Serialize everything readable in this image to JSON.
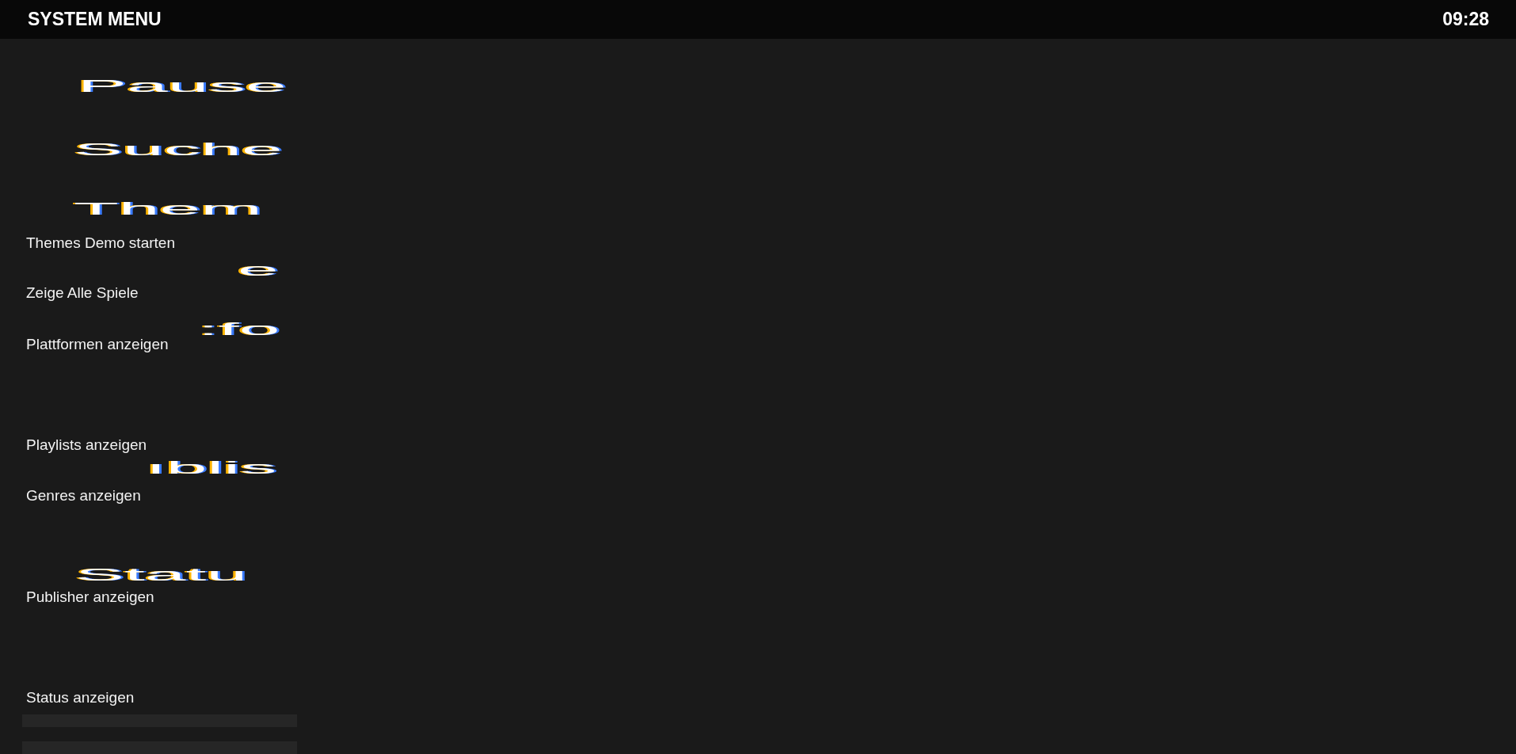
{
  "header": {
    "title": "SYSTEM MENU",
    "clock": "09:28"
  },
  "entries": [
    {
      "kind": "glitch",
      "text": "Pause"
    },
    {
      "kind": "glitch",
      "text": "Suche"
    },
    {
      "kind": "glitch",
      "text": "Them"
    },
    {
      "kind": "item",
      "text": "Themes Demo starten"
    },
    {
      "kind": "glitch",
      "text": "e"
    },
    {
      "kind": "item",
      "text": "Zeige Alle Spiele"
    },
    {
      "kind": "glitch",
      "text": ":fo"
    },
    {
      "kind": "item",
      "text": "Plattformen anzeigen"
    },
    {
      "kind": "item",
      "text": "Playlists anzeigen"
    },
    {
      "kind": "glitch",
      "text": "ıblis"
    },
    {
      "kind": "item",
      "text": "Genres anzeigen"
    },
    {
      "kind": "glitch",
      "text": "Statu"
    },
    {
      "kind": "item",
      "text": "Publisher anzeigen"
    },
    {
      "kind": "item",
      "text": "Status anzeigen"
    },
    {
      "kind": "blank"
    },
    {
      "kind": "blank"
    }
  ]
}
